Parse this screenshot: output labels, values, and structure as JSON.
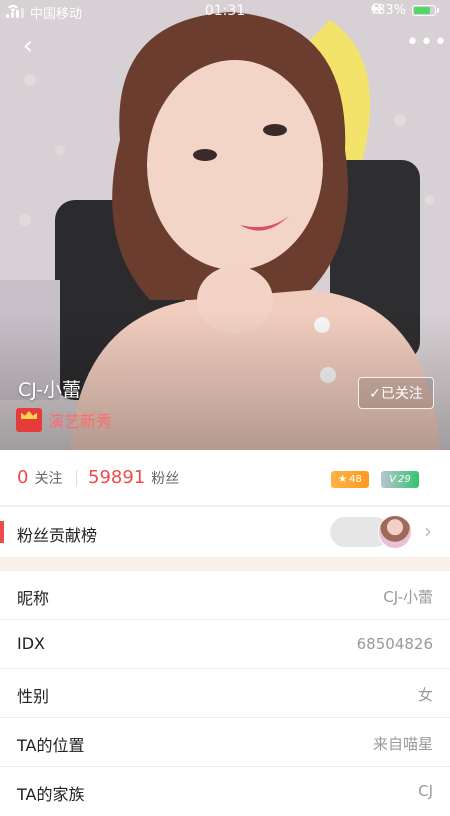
{
  "status_bar": {
    "carrier": "中国移动",
    "time": "01:31",
    "battery": "83%",
    "battery_level": 0.83
  },
  "nav": {
    "back_icon": "back-chevron-icon",
    "more_icon": "more-dots-icon"
  },
  "profile": {
    "name": "CJ-小蕾",
    "level_title": "演艺新秀",
    "follow_label": "✓已关注"
  },
  "stats": {
    "following_count": "0",
    "following_label": "关注",
    "fans_count": "59891",
    "fans_label": "粉丝",
    "star_badge": "48",
    "v_badge": "29"
  },
  "contribution": {
    "title": "粉丝贡献榜"
  },
  "info": [
    {
      "label": "昵称",
      "value": "CJ-小蕾"
    },
    {
      "label": "IDX",
      "value": "68504826"
    },
    {
      "label": "性别",
      "value": "女"
    },
    {
      "label": "TA的位置",
      "value": "来自喵星"
    },
    {
      "label": "TA的家族",
      "value": "CJ"
    }
  ],
  "colors": {
    "accent": "#ef4a4a",
    "divider": "#ececec"
  }
}
